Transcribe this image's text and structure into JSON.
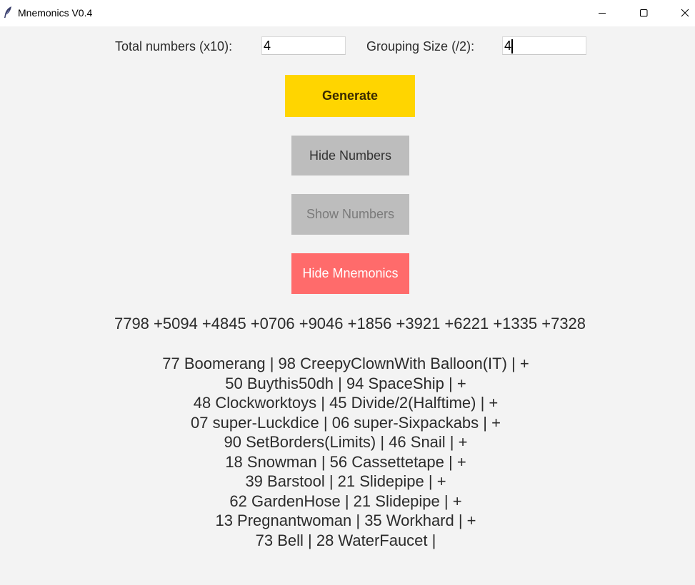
{
  "window": {
    "title": "Mnemonics V0.4",
    "icon": "feather-icon"
  },
  "inputs": {
    "total_label": "Total numbers (x10):",
    "total_value": "4",
    "grouping_label": "Grouping Size (/2):",
    "grouping_value": "4"
  },
  "buttons": {
    "generate": "Generate",
    "hide_numbers": "Hide Numbers",
    "show_numbers": "Show Numbers",
    "hide_mnemonics": "Hide Mnemonics"
  },
  "colors": {
    "generate": "#ffd500",
    "gray_button": "#bdbdbd",
    "hide_mnemonics": "#ff6b6b"
  },
  "numbers_line": "7798 +5094 +4845 +0706 +9046 +1856 +3921 +6221 +1335 +7328",
  "mnemonics": [
    "77 Boomerang | 98 CreepyClownWith Balloon(IT) | +",
    "50 Buythis50dh | 94 SpaceShip | +",
    "48 Clockworktoys | 45 Divide/2(Halftime) | +",
    "07 super-Luckdice | 06 super-Sixpackabs | +",
    "90 SetBorders(Limits) | 46 Snail | +",
    "18 Snowman | 56 Cassettetape | +",
    "39 Barstool | 21 Slidepipe | +",
    "62 GardenHose | 21 Slidepipe | +",
    "13 Pregnantwoman | 35 Workhard | +",
    "73 Bell | 28 WaterFaucet |"
  ]
}
